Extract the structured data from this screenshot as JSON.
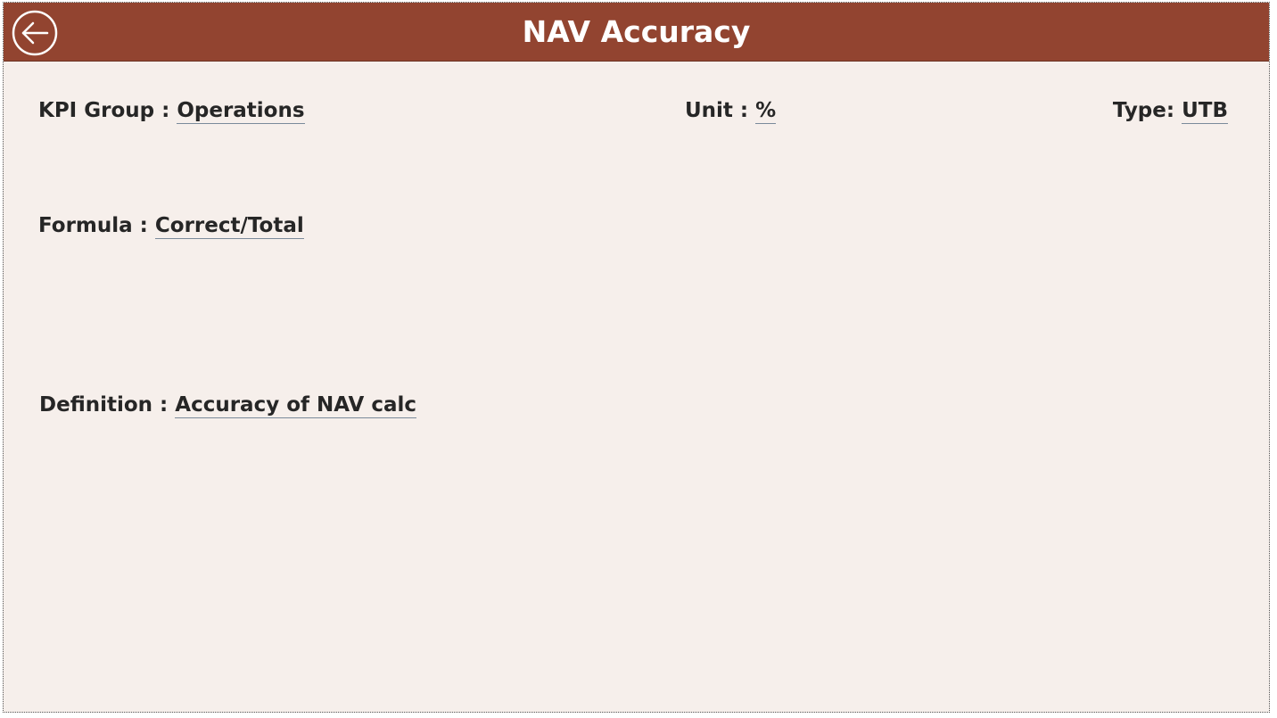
{
  "header": {
    "title": "NAV Accuracy",
    "back_icon": "arrow-left-circle-icon",
    "color": "#924430"
  },
  "fields": {
    "kpi_group": {
      "label": "KPI Group : ",
      "value": "Operations"
    },
    "unit": {
      "label": "Unit : ",
      "value": "%"
    },
    "type": {
      "label": "Type: ",
      "value": "UTB"
    },
    "formula": {
      "label": "Formula : ",
      "value": "Correct/Total"
    },
    "definition": {
      "label": "Definition : ",
      "value": "Accuracy of NAV calc"
    }
  },
  "colors": {
    "background": "#f6efeb",
    "text": "#262626"
  }
}
